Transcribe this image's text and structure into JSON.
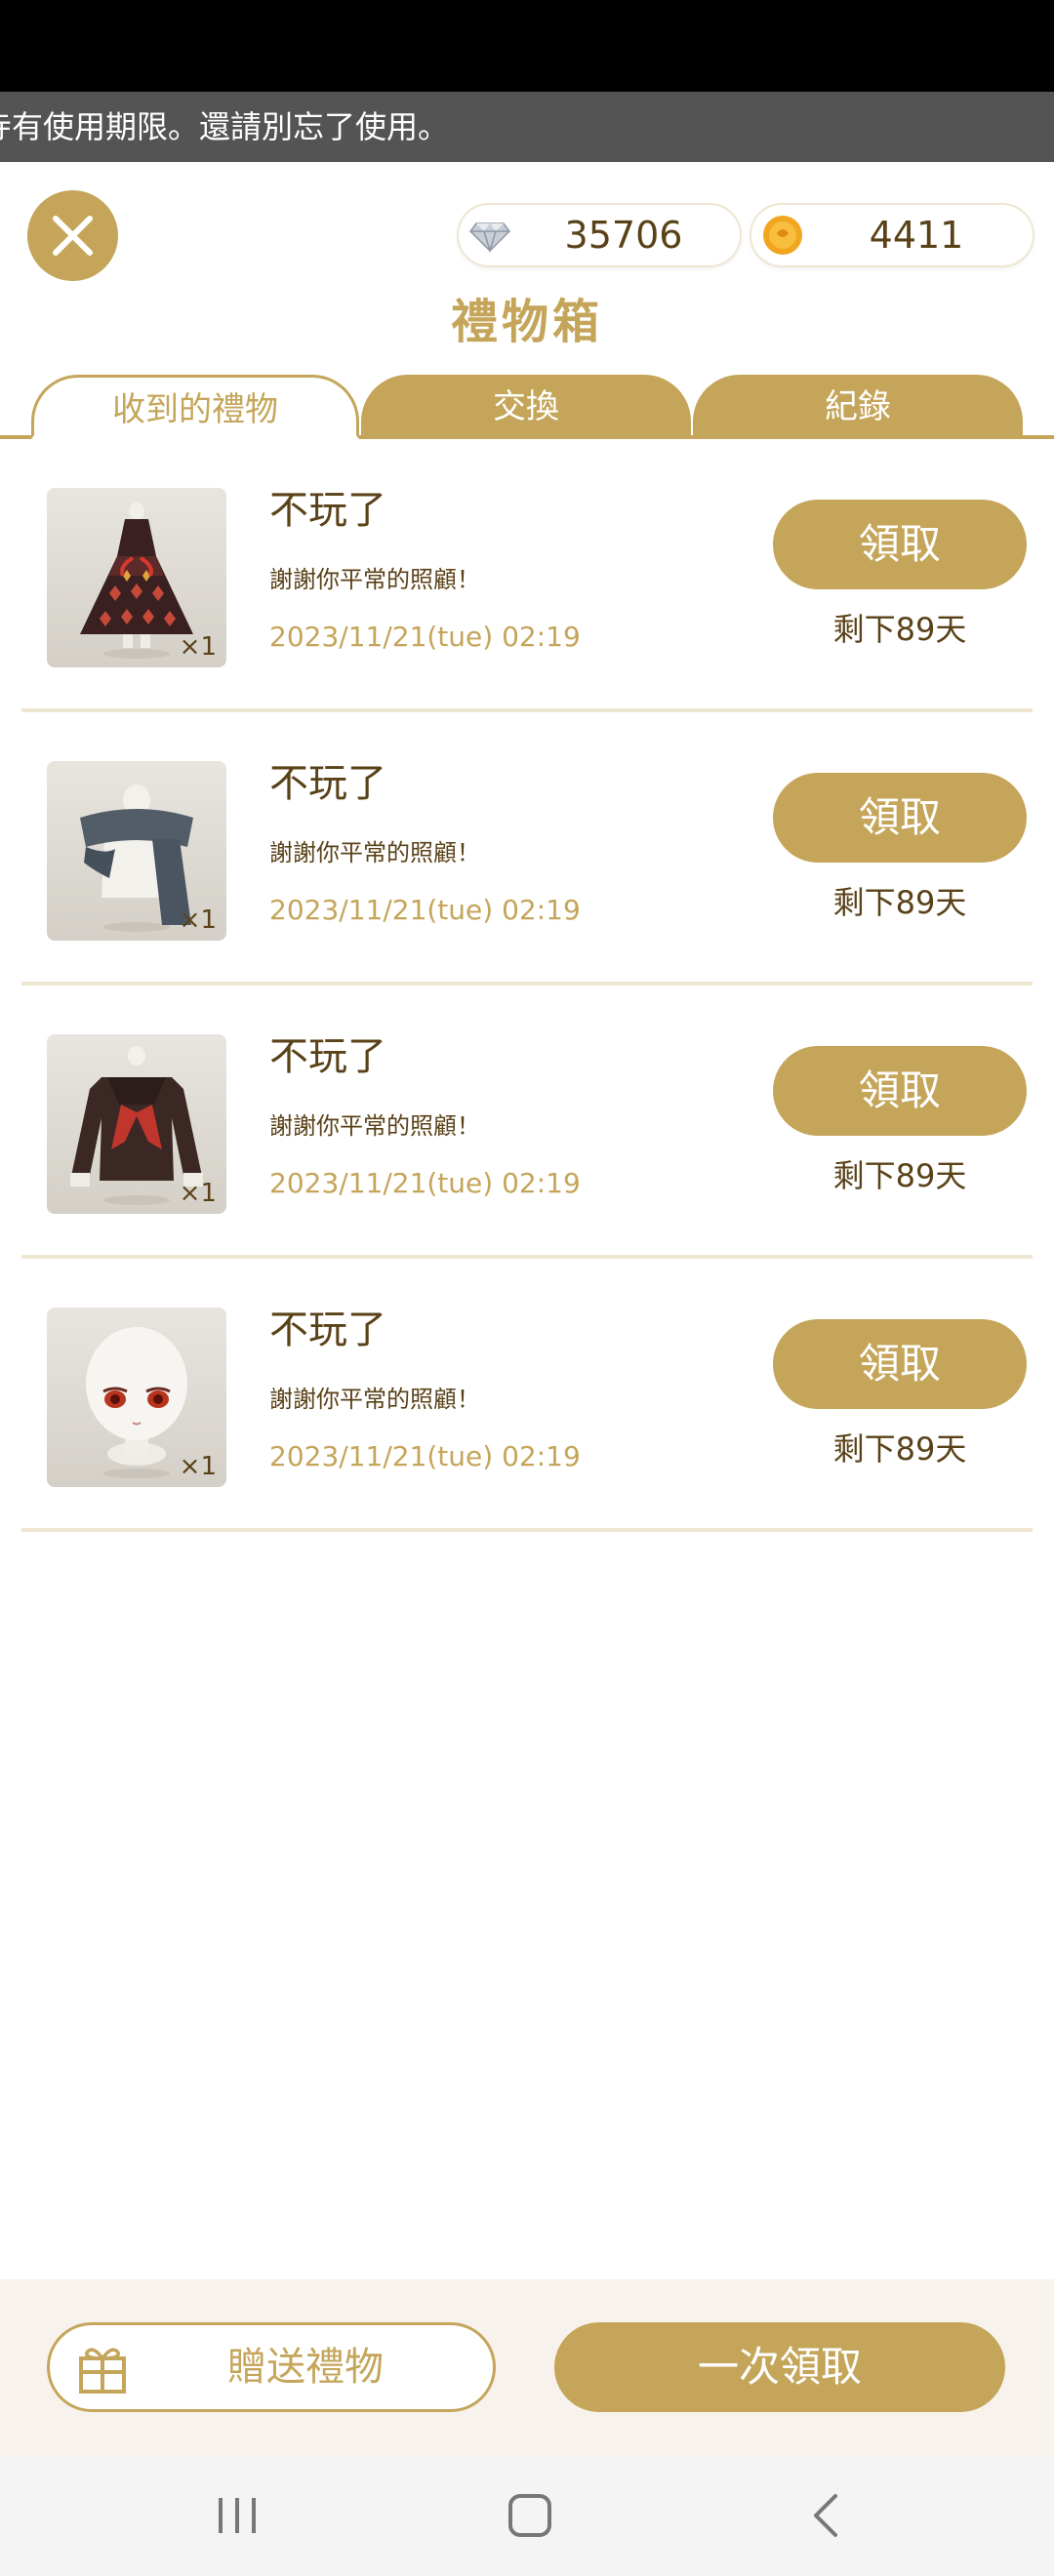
{
  "notice": {
    "text": "寺有使用期限。還請別忘了使用。"
  },
  "currencies": {
    "diamond": {
      "icon": "diamond-icon",
      "value": "35706"
    },
    "coin": {
      "icon": "coin-icon",
      "value": "4411"
    }
  },
  "header": {
    "title": "禮物箱",
    "close_icon": "close-icon"
  },
  "tabs": [
    {
      "label": "收到的禮物",
      "active": true
    },
    {
      "label": "交換",
      "active": false
    },
    {
      "label": "紀錄",
      "active": false
    }
  ],
  "gifts": [
    {
      "item": "dress",
      "quantity": "×1",
      "sender": "不玩了",
      "message": "謝謝你平常的照顧！",
      "date": "2023/11/21(tue) 02:19",
      "claim_label": "領取",
      "remaining": "剩下89天"
    },
    {
      "item": "scarf",
      "quantity": "×1",
      "sender": "不玩了",
      "message": "謝謝你平常的照顧！",
      "date": "2023/11/21(tue) 02:19",
      "claim_label": "領取",
      "remaining": "剩下89天"
    },
    {
      "item": "sailor-top",
      "quantity": "×1",
      "sender": "不玩了",
      "message": "謝謝你平常的照顧！",
      "date": "2023/11/21(tue) 02:19",
      "claim_label": "領取",
      "remaining": "剩下89天"
    },
    {
      "item": "face",
      "quantity": "×1",
      "sender": "不玩了",
      "message": "謝謝你平常的照顧！",
      "date": "2023/11/21(tue) 02:19",
      "claim_label": "領取",
      "remaining": "剩下89天"
    }
  ],
  "footer": {
    "send_label": "贈送禮物",
    "send_icon": "gift-icon",
    "claim_all_label": "一次領取"
  },
  "colors": {
    "gold": "#c4a55a",
    "brown": "#5a4218",
    "divider": "#efe6d2",
    "bottom_bg": "#f7f3ec"
  },
  "navbar": {
    "icons": [
      "recents-icon",
      "home-icon",
      "back-icon"
    ]
  }
}
